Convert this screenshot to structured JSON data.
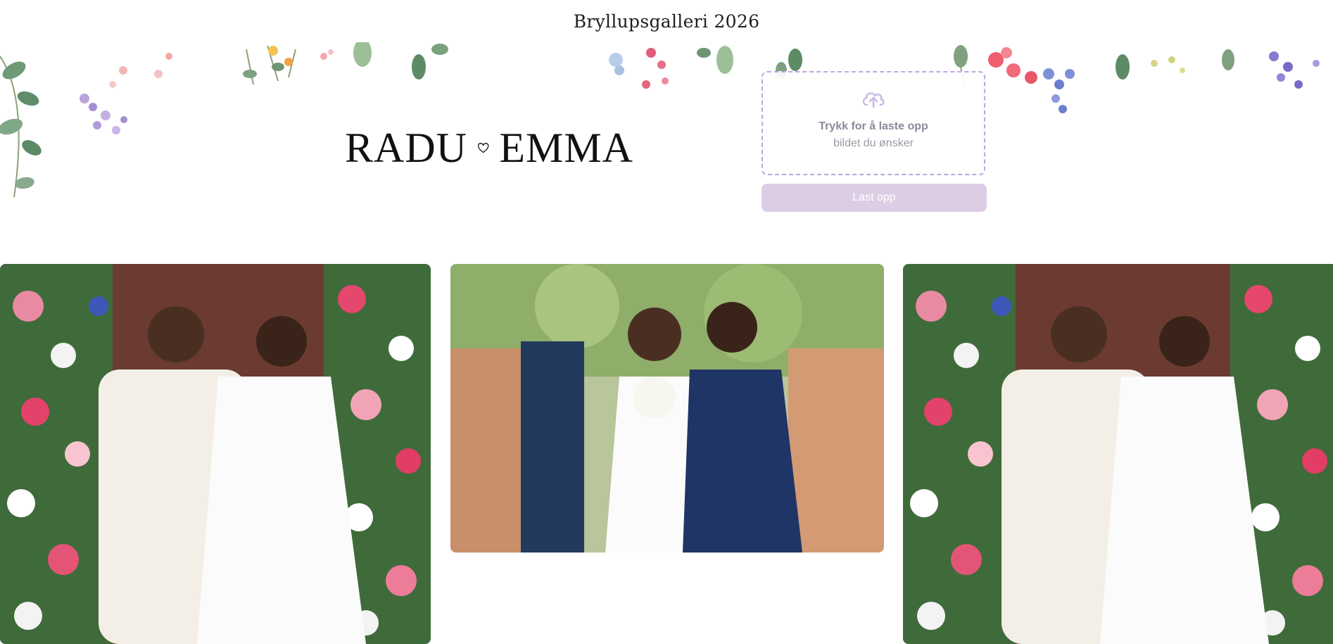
{
  "header": {
    "title": "Bryllupsgalleri 2026"
  },
  "hero": {
    "name_left": "RADU",
    "name_right": "EMMA",
    "upload": {
      "title": "Trykk for å laste opp",
      "subtitle": "bildet du ønsker",
      "button_label": "Last opp"
    }
  },
  "colors": {
    "upload_border": "#b8a8e0",
    "button_bg": "#dccde4",
    "text_dark": "#111111"
  },
  "icons": {
    "heart": "heart-icon",
    "upload": "cloud-upload-icon"
  },
  "gallery": [
    {
      "photo": "couple-on-steps"
    },
    {
      "photo": "couple-walking-through-guests"
    },
    {
      "photo": "couple-on-steps"
    }
  ]
}
